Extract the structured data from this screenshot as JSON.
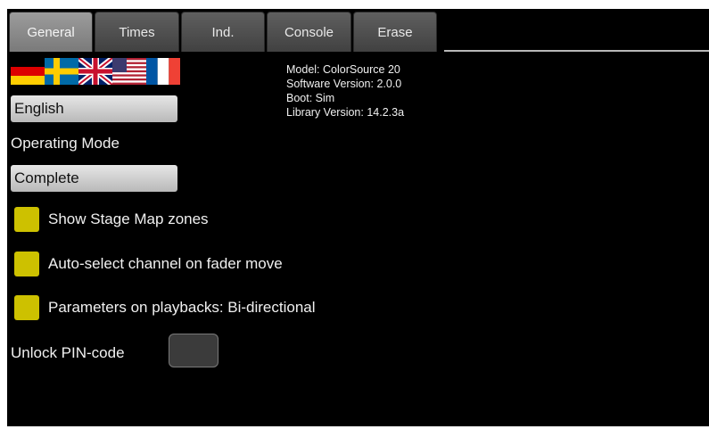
{
  "tabs": [
    {
      "label": "General",
      "active": true
    },
    {
      "label": "Times",
      "active": false
    },
    {
      "label": "Ind.",
      "active": false
    },
    {
      "label": "Console",
      "active": false
    },
    {
      "label": "Erase",
      "active": false
    }
  ],
  "languages": {
    "flags": [
      "de-flag-icon",
      "se-flag-icon",
      "uk-flag-icon",
      "us-flag-icon",
      "fr-flag-icon"
    ],
    "selected": "English"
  },
  "operating_mode": {
    "label": "Operating Mode",
    "selected": "Complete"
  },
  "info": {
    "model": "Model: ColorSource 20",
    "software_version": "Software Version: 2.0.0",
    "boot": "Boot: Sim",
    "library_version": "Library Version: 14.2.3a"
  },
  "options": [
    {
      "label": "Show Stage Map zones",
      "checked": true
    },
    {
      "label": "Auto-select channel on fader move",
      "checked": true
    },
    {
      "label": "Parameters on playbacks: Bi-directional",
      "checked": true
    }
  ],
  "pin": {
    "label": "Unlock PIN-code",
    "value": ""
  },
  "colors": {
    "background": "#000000",
    "checkbox": "#cdc100",
    "tab_active": "#8a8a8a",
    "tab_inactive": "#4d4d4d"
  }
}
